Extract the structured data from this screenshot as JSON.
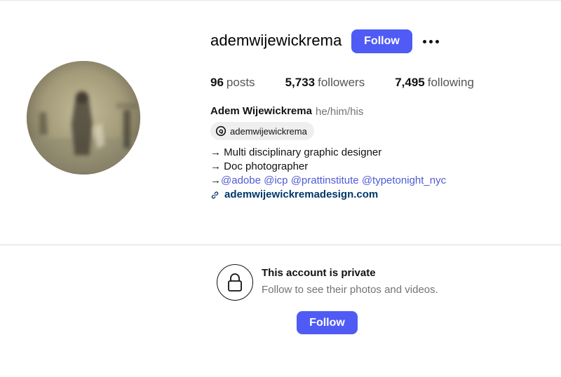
{
  "profile": {
    "username": "ademwijewickrema",
    "follow_label": "Follow",
    "full_name": "Adem Wijewickrema",
    "pronouns": "he/him/his",
    "threads_handle": "ademwijewickrema"
  },
  "stats": [
    {
      "count": "96",
      "label": "posts"
    },
    {
      "count": "5,733",
      "label": "followers"
    },
    {
      "count": "7,495",
      "label": "following"
    }
  ],
  "bio": {
    "line1": "→ Multi disciplinary graphic designer",
    "line2": "→ Doc photographer",
    "line3_prefix": "→",
    "mentions": [
      "@adobe",
      "@icp",
      "@prattinstitute",
      "@typetonight_nyc"
    ],
    "website": "ademwijewickremadesign.com"
  },
  "private": {
    "title": "This account is private",
    "subtitle": "Follow to see their photos and videos.",
    "follow_label": "Follow"
  },
  "icons": {
    "more": "more-options-icon",
    "threads": "threads-icon",
    "link": "link-icon",
    "lock": "lock-icon"
  },
  "colors": {
    "accent": "#4f5bf4",
    "mention": "#4f5bd5",
    "website": "#00376b",
    "muted": "#737373"
  }
}
